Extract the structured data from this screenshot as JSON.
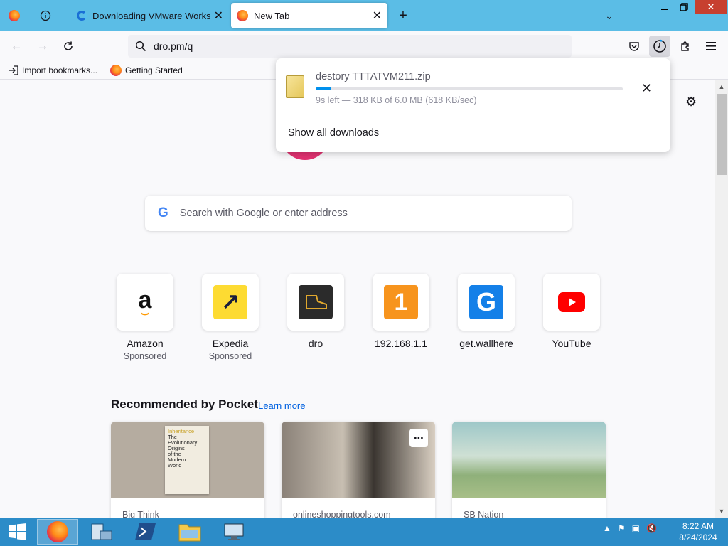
{
  "tabs": [
    {
      "title": "Downloading VMware Workstation",
      "active": false
    },
    {
      "title": "New Tab",
      "active": true
    }
  ],
  "toolbar": {
    "url": "dro.pm/q"
  },
  "bookmarks": [
    {
      "label": "Import bookmarks..."
    },
    {
      "label": "Getting Started"
    }
  ],
  "search": {
    "placeholder": "Search with Google or enter address"
  },
  "top_sites": [
    {
      "name": "Amazon",
      "sponsor": "Sponsored"
    },
    {
      "name": "Expedia",
      "sponsor": "Sponsored"
    },
    {
      "name": "dro",
      "sponsor": ""
    },
    {
      "name": "192.168.1.1",
      "sponsor": ""
    },
    {
      "name": "get.wallhere",
      "sponsor": ""
    },
    {
      "name": "YouTube",
      "sponsor": ""
    }
  ],
  "pocket": {
    "title": "Recommended by Pocket",
    "learn_more": "Learn more",
    "cards": [
      {
        "source": "Big Think",
        "cover_lines": [
          "Inheritance",
          "The",
          "Evolutionary",
          "Origins",
          "of the",
          "Modern",
          "World"
        ]
      },
      {
        "source": "onlineshoppingtools.com"
      },
      {
        "source": "SB Nation"
      }
    ]
  },
  "download": {
    "filename": "destory TTTATVM211.zip",
    "status": "9s left — 318 KB of 6.0 MB (618 KB/sec)",
    "progress": 0.05,
    "show_all": "Show all downloads"
  },
  "taskbar": {
    "time": "8:22 AM",
    "date": "8/24/2024"
  },
  "colors": {
    "tabstrip": "#5bbde6",
    "taskbar": "#2c8cc8",
    "accent": "#0090ed"
  }
}
